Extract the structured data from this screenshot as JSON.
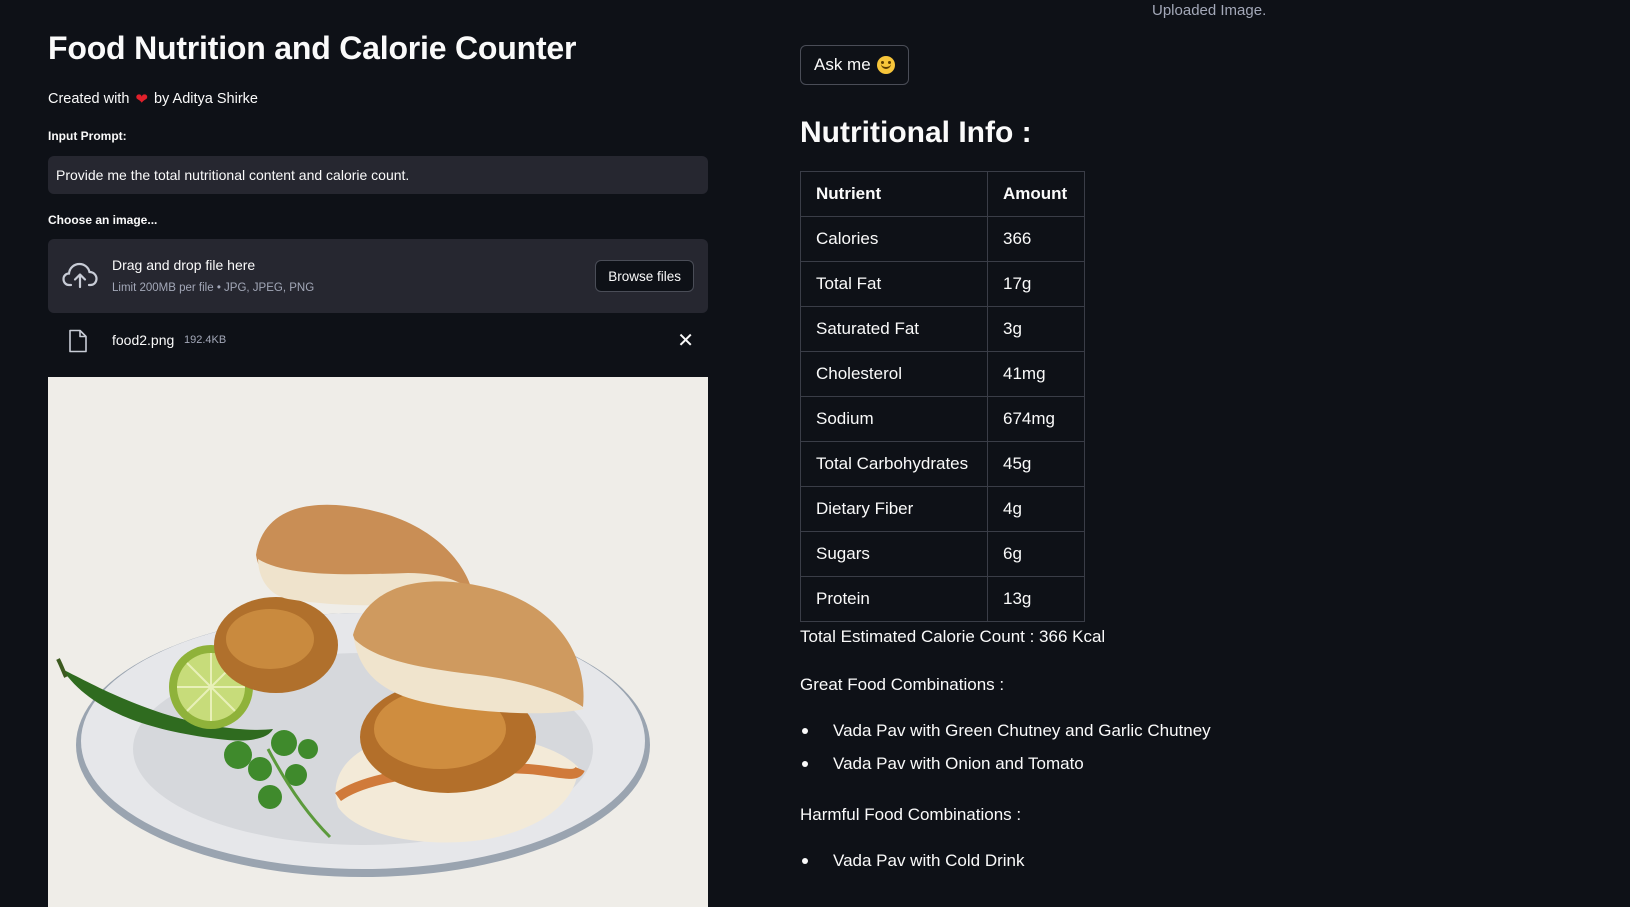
{
  "app": {
    "title": "Food Nutrition and Calorie Counter",
    "credit_prefix": "Created with",
    "credit_heart": "❤",
    "credit_suffix": "by Aditya Shirke"
  },
  "prompt": {
    "label": "Input Prompt:",
    "value": "Provide me the total nutritional content and calorie count."
  },
  "uploader": {
    "label": "Choose an image...",
    "drop_title": "Drag and drop file here",
    "limit_text": "Limit 200MB per file • JPG, JPEG, PNG",
    "browse_label": "Browse files",
    "file_name": "food2.png",
    "file_size": "192.4KB",
    "remove_icon": "close-icon"
  },
  "image": {
    "caption": "Uploaded Image."
  },
  "ask_button": {
    "label": "Ask me",
    "icon": "smiley-icon"
  },
  "nutrition": {
    "title": "Nutritional Info :",
    "headers": [
      "Nutrient",
      "Amount"
    ],
    "rows": [
      {
        "nutrient": "Calories",
        "amount": "366"
      },
      {
        "nutrient": "Total Fat",
        "amount": "17g"
      },
      {
        "nutrient": "Saturated Fat",
        "amount": "3g"
      },
      {
        "nutrient": "Cholesterol",
        "amount": "41mg"
      },
      {
        "nutrient": "Sodium",
        "amount": "674mg"
      },
      {
        "nutrient": "Total Carbohydrates",
        "amount": "45g"
      },
      {
        "nutrient": "Dietary Fiber",
        "amount": "4g"
      },
      {
        "nutrient": "Sugars",
        "amount": "6g"
      },
      {
        "nutrient": "Protein",
        "amount": "13g"
      }
    ],
    "total_text": "Total Estimated Calorie Count : 366 Kcal"
  },
  "combinations": {
    "great_heading": "Great Food Combinations :",
    "great": [
      "Vada Pav with Green Chutney and Garlic Chutney",
      "Vada Pav with Onion and Tomato"
    ],
    "harmful_heading": "Harmful Food Combinations :",
    "harmful": [
      "Vada Pav with Cold Drink"
    ]
  },
  "colors": {
    "background": "#0e1117",
    "widget": "#262730",
    "text": "#fafafa",
    "muted": "#a3a8b8",
    "heart": "#e0202b"
  }
}
